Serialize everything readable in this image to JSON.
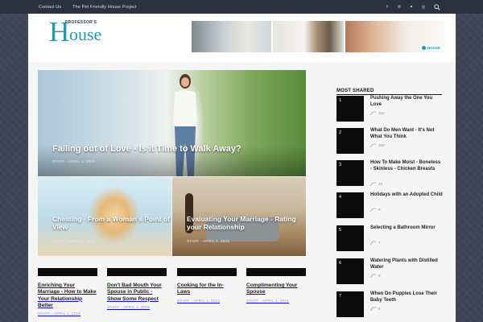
{
  "topnav": {
    "items": [
      "Contact Us",
      "The Pet Friendly House Project"
    ]
  },
  "social": {
    "icons": [
      "facebook-icon",
      "pinterest-icon",
      "twitter-icon",
      "instagram-icon",
      "search-icon"
    ],
    "glyphs": [
      "f",
      "℗",
      "✦",
      "◎"
    ]
  },
  "logo": {
    "small": "PROFESSOR'S",
    "big_letter": "H",
    "rest": "ouse"
  },
  "banner": {
    "logo_text": "HOUSE"
  },
  "featured": {
    "main": {
      "title": "Falling out of Love - Is it Time to Walk Away?",
      "meta": "STAFF - APRIL 1, 2015"
    },
    "left": {
      "title": "Cheating - From a Woman's Point of View",
      "meta": "STAFF - APRIL 1, 2015"
    },
    "right": {
      "title": "Evaluating Your Marriage - Rating your Relationship",
      "meta": "STAFF - APRIL 1, 2015"
    }
  },
  "posts": [
    {
      "title": "Enriching Your Marriage - How to Make Your Relationship Better",
      "meta": "STAFF - APRIL 1, 2015"
    },
    {
      "title": "Don't Bad Mouth Your Spouse in Public - Show Some Respect",
      "meta": "STAFF - APRIL 1, 2015"
    },
    {
      "title": "Cooking for the In-Laws",
      "meta": "STAFF - APRIL 1, 2015"
    },
    {
      "title": "Complimenting Your Spouse",
      "meta": "STAFF - APRIL 1, 2015"
    }
  ],
  "sidebar": {
    "title": "MOST SHARED",
    "items": [
      {
        "num": "1",
        "title": "Pushing Away the One You Love",
        "count": "102"
      },
      {
        "num": "2",
        "title": "What Do Men Want - It's Not What You Think",
        "count": "100"
      },
      {
        "num": "3",
        "title": "How To Make Moist - Boneless - Skinless - Chicken Breasts",
        "count": "10"
      },
      {
        "num": "4",
        "title": "Holidays with an Adopted Child",
        "count": "9"
      },
      {
        "num": "5",
        "title": "Selecting a Bathroom Mirror",
        "count": "7"
      },
      {
        "num": "6",
        "title": "Watering Plants with Distilled Water",
        "count": "5"
      },
      {
        "num": "7",
        "title": "When Do Puppies Lose Their Baby Teeth",
        "count": "5"
      }
    ]
  },
  "colors": {
    "brand": "#1d9bb3",
    "topbar": "#2c3140",
    "background": "#3f4656"
  }
}
